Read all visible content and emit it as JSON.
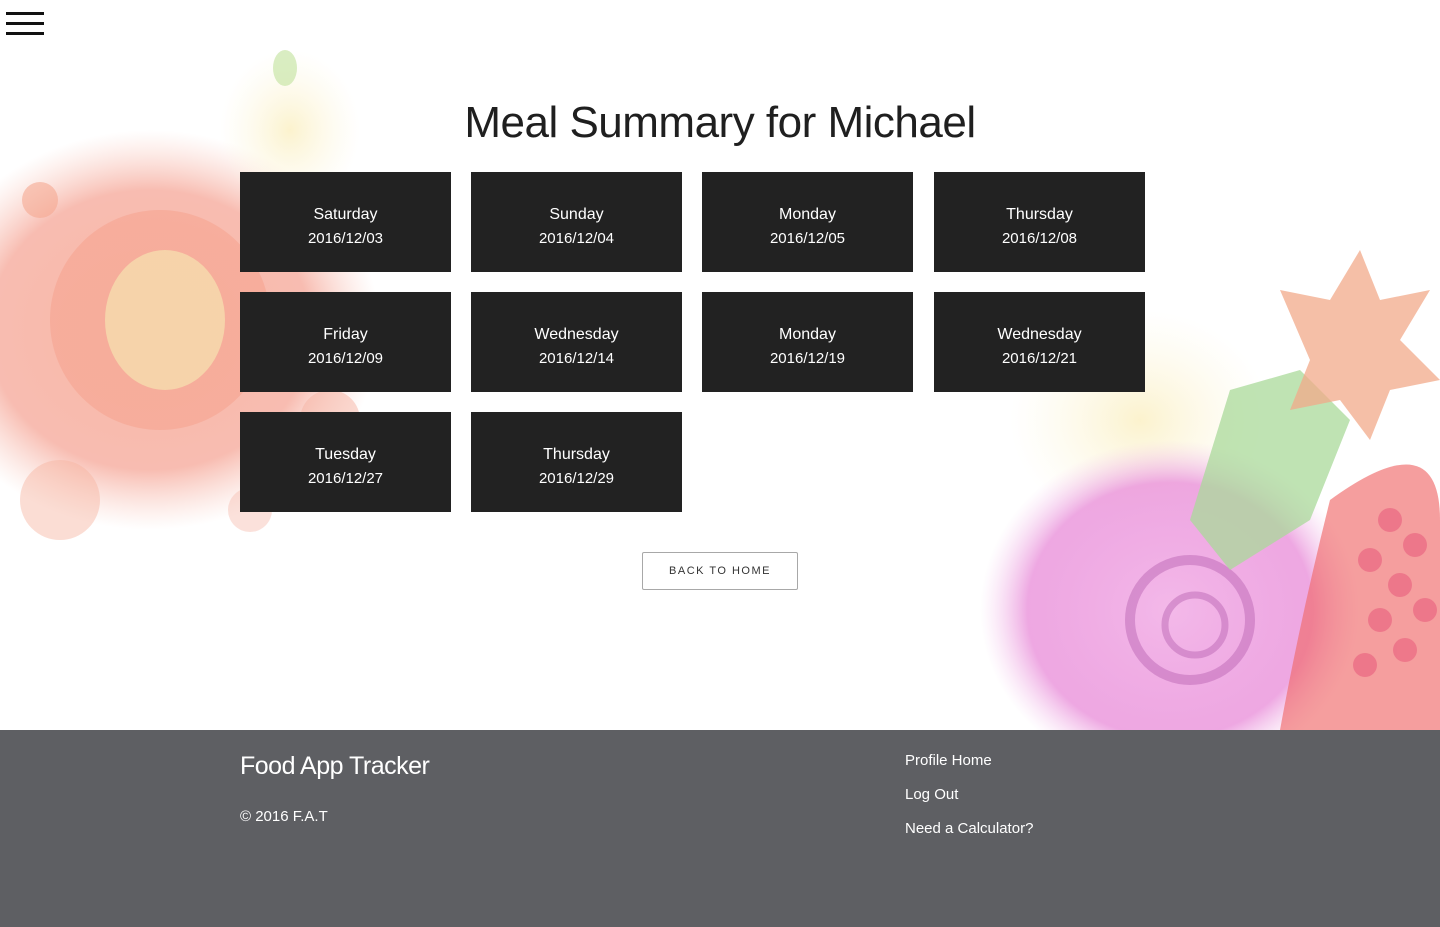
{
  "nav": {
    "menu_icon": "hamburger-icon"
  },
  "page": {
    "title": "Meal Summary for Michael"
  },
  "days": [
    {
      "day": "Saturday",
      "date": "2016/12/03"
    },
    {
      "day": "Sunday",
      "date": "2016/12/04"
    },
    {
      "day": "Monday",
      "date": "2016/12/05"
    },
    {
      "day": "Thursday",
      "date": "2016/12/08"
    },
    {
      "day": "Friday",
      "date": "2016/12/09"
    },
    {
      "day": "Wednesday",
      "date": "2016/12/14"
    },
    {
      "day": "Monday",
      "date": "2016/12/19"
    },
    {
      "day": "Wednesday",
      "date": "2016/12/21"
    },
    {
      "day": "Tuesday",
      "date": "2016/12/27"
    },
    {
      "day": "Thursday",
      "date": "2016/12/29"
    }
  ],
  "actions": {
    "back_label": "BACK TO HOME"
  },
  "footer": {
    "brand": "Food App Tracker",
    "copyright": "© 2016 F.A.T",
    "links": [
      "Profile Home",
      "Log Out",
      "Need a Calculator?"
    ]
  },
  "colors": {
    "card_bg": "#222222",
    "footer_bg": "#5e5f63",
    "text_dark": "#1f1f1f"
  }
}
